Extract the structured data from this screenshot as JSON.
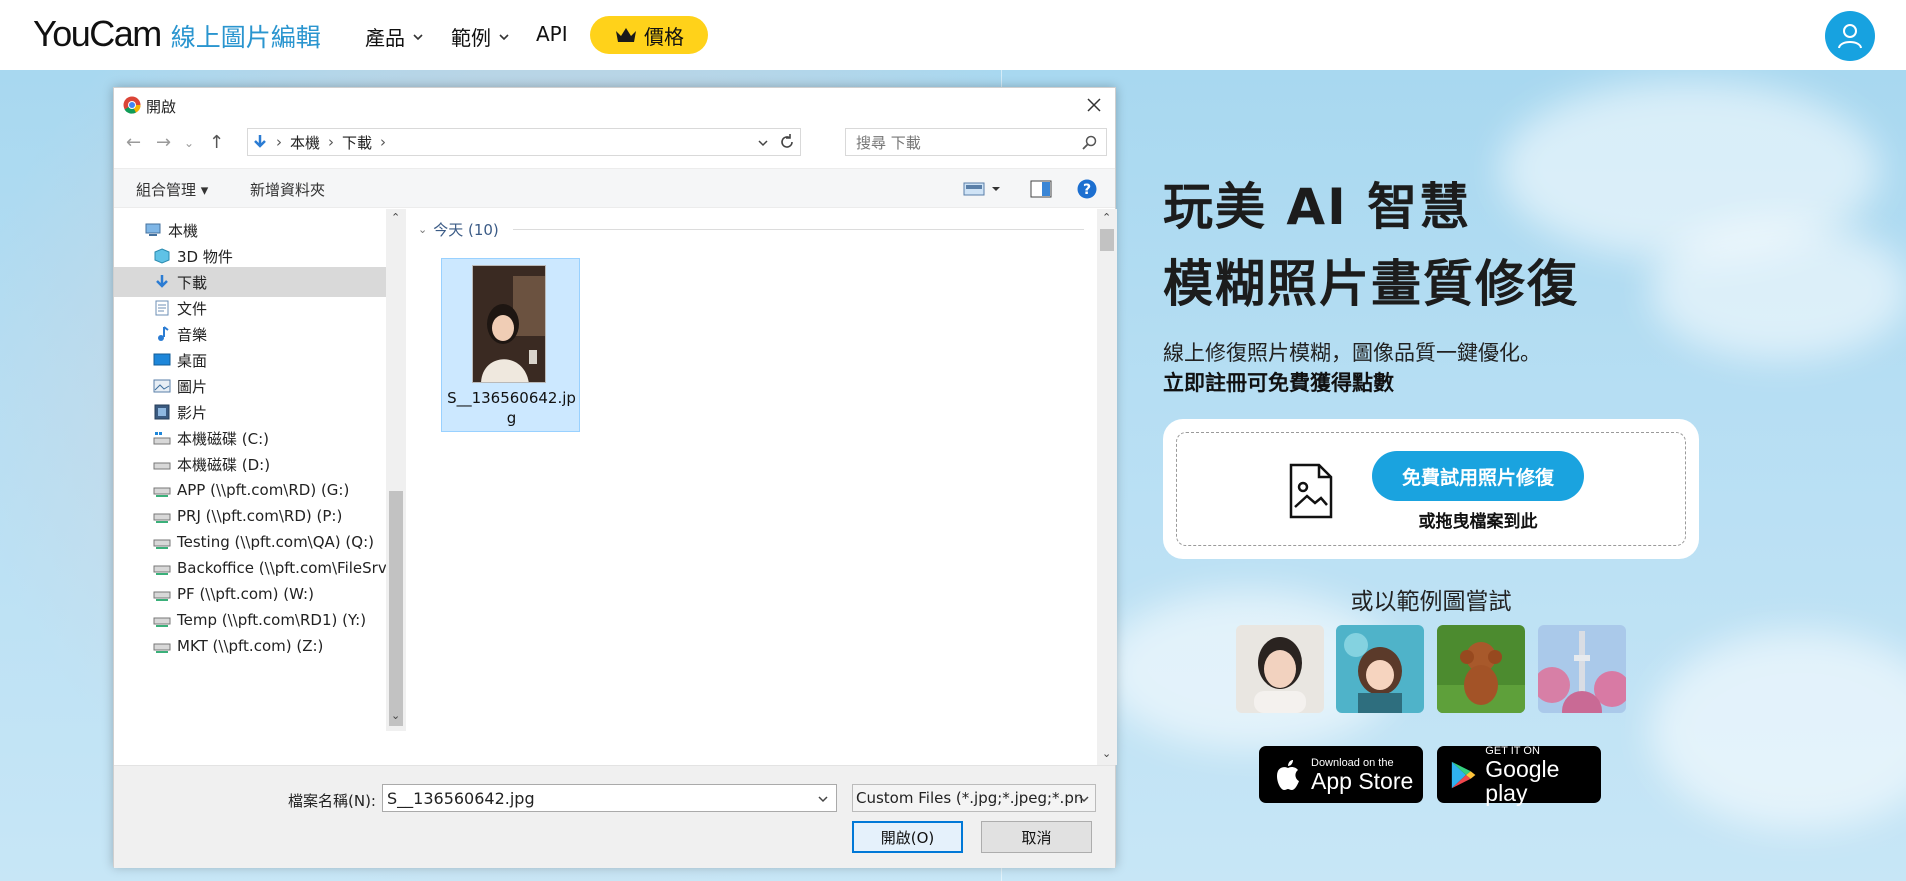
{
  "nav": {
    "brand": "YouCam",
    "brand_sub": "線上圖片編輯",
    "items": [
      {
        "label": "產品"
      },
      {
        "label": "範例"
      },
      {
        "label": "API"
      }
    ],
    "price_label": "價格",
    "brand_color": "#2a95cf",
    "accent_color": "#ffd21a"
  },
  "hero": {
    "title_line1": "玩美 AI 智慧",
    "title_line2": "模糊照片畫質修復",
    "desc": "線上修復照片模糊，圖像品質一鍵優化。",
    "desc_bold": "立即註冊可免費獲得點數",
    "try_button": "免費試用照片修復",
    "drag_text": "或拖曳檔案到此",
    "sample_title": "或以範例圖嘗試",
    "samples": [
      {
        "icon": "portrait-photo"
      },
      {
        "icon": "anime-girl-photo"
      },
      {
        "icon": "poodle-photo"
      },
      {
        "icon": "tower-cherry-blossom-photo"
      }
    ],
    "app_store": {
      "small": "Download on the",
      "big": "App Store"
    },
    "google_play": {
      "small": "GET IT ON",
      "big": "Google play"
    },
    "button_color": "#1aa3df"
  },
  "dialog": {
    "title": "開啟",
    "breadcrumb": [
      "本機",
      "下載"
    ],
    "search_placeholder": "搜尋 下載",
    "toolbar": {
      "organize": "組合管理",
      "new_folder": "新增資料夾"
    },
    "tree": [
      {
        "label": "本機",
        "icon": "computer-icon"
      },
      {
        "label": "3D 物件",
        "icon": "cube-icon"
      },
      {
        "label": "下載",
        "icon": "download-arrow-icon",
        "selected": true
      },
      {
        "label": "文件",
        "icon": "document-icon"
      },
      {
        "label": "音樂",
        "icon": "music-note-icon"
      },
      {
        "label": "桌面",
        "icon": "desktop-icon"
      },
      {
        "label": "圖片",
        "icon": "pictures-icon"
      },
      {
        "label": "影片",
        "icon": "video-icon"
      },
      {
        "label": "本機磁碟 (C:)",
        "icon": "drive-icon"
      },
      {
        "label": "本機磁碟 (D:)",
        "icon": "drive-icon"
      },
      {
        "label": "APP (\\\\pft.com\\RD) (G:)",
        "icon": "network-drive-icon"
      },
      {
        "label": "PRJ (\\\\pft.com\\RD) (P:)",
        "icon": "network-drive-icon"
      },
      {
        "label": "Testing (\\\\pft.com\\QA) (Q:)",
        "icon": "network-drive-icon"
      },
      {
        "label": "Backoffice (\\\\pft.com\\FileSrv)",
        "icon": "network-drive-icon"
      },
      {
        "label": "PF (\\\\pft.com) (W:)",
        "icon": "network-drive-icon"
      },
      {
        "label": "Temp (\\\\pft.com\\RD1) (Y:)",
        "icon": "network-drive-icon"
      },
      {
        "label": "MKT (\\\\pft.com) (Z:)",
        "icon": "network-drive-icon"
      }
    ],
    "group_header": "今天 (10)",
    "file": {
      "name": "S__136560642.jpg",
      "icon": "photo-thumbnail"
    },
    "filename_label": "檔案名稱(N):",
    "filename_value": "S__136560642.jpg",
    "filetype": "Custom Files (*.jpg;*.jpeg;*.pn",
    "open_button": "開啟(O)",
    "cancel_button": "取消"
  }
}
